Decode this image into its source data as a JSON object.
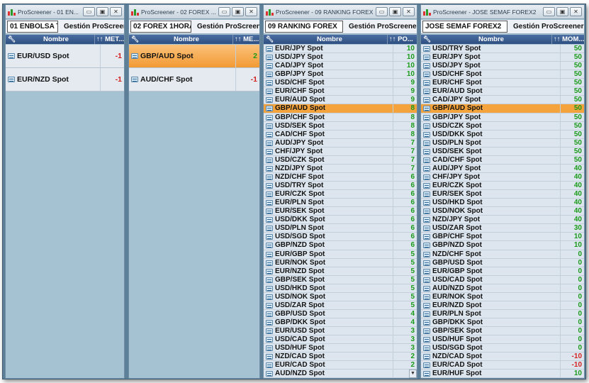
{
  "colors": {
    "highlight": "#f5a43d",
    "positive": "#1a9a1a",
    "negative": "#d41f1f",
    "header_bg": "#2e4f80"
  },
  "windows": [
    {
      "title": "ProScreener - 01 EN...",
      "tab": "01 ENBOLSA T",
      "gestion": "Gestión ProScreener",
      "col_name": "Nombre",
      "col_value": "↑↑ MET...",
      "rows": [
        {
          "name": "EUR/USD Spot",
          "value": "-1"
        },
        {
          "name": "EUR/NZD Spot",
          "value": "-1"
        }
      ]
    },
    {
      "title": "ProScreener - 02 FOREX ...",
      "tab": "02 FOREX 1HORA",
      "gestion": "Gestión ProScreener",
      "col_name": "Nombre",
      "col_value": "↑↑ ME...",
      "rows": [
        {
          "name": "GBP/AUD Spot",
          "value": "2",
          "highlight": true
        },
        {
          "name": "AUD/CHF Spot",
          "value": "-1"
        }
      ]
    },
    {
      "title": "ProScreener - 09 RANKING FOREX",
      "tab": "09 RANKING FOREX",
      "gestion": "Gestión ProScreener",
      "col_name": "Nombre",
      "col_value": "↑↑ PO...",
      "rows": [
        {
          "name": "EUR/JPY Spot",
          "value": "10"
        },
        {
          "name": "USD/JPY Spot",
          "value": "10"
        },
        {
          "name": "CAD/JPY Spot",
          "value": "10"
        },
        {
          "name": "GBP/JPY Spot",
          "value": "10"
        },
        {
          "name": "USD/CHF Spot",
          "value": "9"
        },
        {
          "name": "EUR/CHF Spot",
          "value": "9"
        },
        {
          "name": "EUR/AUD Spot",
          "value": "9"
        },
        {
          "name": "GBP/AUD Spot",
          "value": "8",
          "highlight": true
        },
        {
          "name": "GBP/CHF Spot",
          "value": "8"
        },
        {
          "name": "USD/SEK Spot",
          "value": "8"
        },
        {
          "name": "CAD/CHF Spot",
          "value": "8"
        },
        {
          "name": "AUD/JPY Spot",
          "value": "7"
        },
        {
          "name": "CHF/JPY Spot",
          "value": "7"
        },
        {
          "name": "USD/CZK Spot",
          "value": "7"
        },
        {
          "name": "NZD/JPY Spot",
          "value": "7"
        },
        {
          "name": "NZD/CHF Spot",
          "value": "6"
        },
        {
          "name": "USD/TRY Spot",
          "value": "6"
        },
        {
          "name": "EUR/CZK Spot",
          "value": "6"
        },
        {
          "name": "EUR/PLN Spot",
          "value": "6"
        },
        {
          "name": "EUR/SEK Spot",
          "value": "6"
        },
        {
          "name": "USD/DKK Spot",
          "value": "6"
        },
        {
          "name": "USD/PLN Spot",
          "value": "6"
        },
        {
          "name": "USD/SGD Spot",
          "value": "6"
        },
        {
          "name": "GBP/NZD Spot",
          "value": "6"
        },
        {
          "name": "EUR/GBP Spot",
          "value": "5"
        },
        {
          "name": "EUR/NOK Spot",
          "value": "5"
        },
        {
          "name": "EUR/NZD Spot",
          "value": "5"
        },
        {
          "name": "GBP/SEK Spot",
          "value": "5"
        },
        {
          "name": "USD/HKD Spot",
          "value": "5"
        },
        {
          "name": "USD/NOK Spot",
          "value": "5"
        },
        {
          "name": "USD/ZAR Spot",
          "value": "5"
        },
        {
          "name": "GBP/USD Spot",
          "value": "4"
        },
        {
          "name": "GBP/DKK Spot",
          "value": "4"
        },
        {
          "name": "EUR/USD Spot",
          "value": "3"
        },
        {
          "name": "USD/CAD Spot",
          "value": "3"
        },
        {
          "name": "USD/HUF Spot",
          "value": "3"
        },
        {
          "name": "NZD/CAD Spot",
          "value": "2"
        },
        {
          "name": "EUR/CAD Spot",
          "value": "2"
        },
        {
          "name": "AUD/NZD Spot",
          "value": "2"
        }
      ]
    },
    {
      "title": "ProScreener - JOSE SEMAF FOREX2",
      "tab": "JOSE SEMAF FOREX2",
      "gestion": "Gestión ProScreeners",
      "col_name": "Nombre",
      "col_value": "↑↑ MOM...",
      "rows": [
        {
          "name": "USD/TRY Spot",
          "value": "50"
        },
        {
          "name": "EUR/JPY Spot",
          "value": "50"
        },
        {
          "name": "USD/JPY Spot",
          "value": "50"
        },
        {
          "name": "USD/CHF Spot",
          "value": "50"
        },
        {
          "name": "EUR/CHF Spot",
          "value": "50"
        },
        {
          "name": "EUR/AUD Spot",
          "value": "50"
        },
        {
          "name": "CAD/JPY Spot",
          "value": "50"
        },
        {
          "name": "GBP/AUD Spot",
          "value": "50",
          "highlight": true
        },
        {
          "name": "GBP/JPY Spot",
          "value": "50"
        },
        {
          "name": "USD/CZK Spot",
          "value": "50"
        },
        {
          "name": "USD/DKK Spot",
          "value": "50"
        },
        {
          "name": "USD/PLN Spot",
          "value": "50"
        },
        {
          "name": "USD/SEK Spot",
          "value": "50"
        },
        {
          "name": "CAD/CHF Spot",
          "value": "50"
        },
        {
          "name": "AUD/JPY Spot",
          "value": "40"
        },
        {
          "name": "CHF/JPY Spot",
          "value": "40"
        },
        {
          "name": "EUR/CZK Spot",
          "value": "40"
        },
        {
          "name": "EUR/SEK Spot",
          "value": "40"
        },
        {
          "name": "USD/HKD Spot",
          "value": "40"
        },
        {
          "name": "USD/NOK Spot",
          "value": "40"
        },
        {
          "name": "NZD/JPY Spot",
          "value": "40"
        },
        {
          "name": "USD/ZAR Spot",
          "value": "30"
        },
        {
          "name": "GBP/CHF Spot",
          "value": "10"
        },
        {
          "name": "GBP/NZD Spot",
          "value": "10"
        },
        {
          "name": "NZD/CHF Spot",
          "value": "0"
        },
        {
          "name": "GBP/USD Spot",
          "value": "0"
        },
        {
          "name": "EUR/GBP Spot",
          "value": "0"
        },
        {
          "name": "USD/CAD Spot",
          "value": "0"
        },
        {
          "name": "AUD/NZD Spot",
          "value": "0"
        },
        {
          "name": "EUR/NOK Spot",
          "value": "0"
        },
        {
          "name": "EUR/NZD Spot",
          "value": "0"
        },
        {
          "name": "EUR/PLN Spot",
          "value": "0"
        },
        {
          "name": "GBP/DKK Spot",
          "value": "0"
        },
        {
          "name": "GBP/SEK Spot",
          "value": "0"
        },
        {
          "name": "USD/HUF Spot",
          "value": "0"
        },
        {
          "name": "USD/SGD Spot",
          "value": "0"
        },
        {
          "name": "NZD/CAD Spot",
          "value": "-10"
        },
        {
          "name": "EUR/CAD Spot",
          "value": "-10"
        },
        {
          "name": "EUR/HUF Spot",
          "value": "10"
        }
      ]
    }
  ]
}
